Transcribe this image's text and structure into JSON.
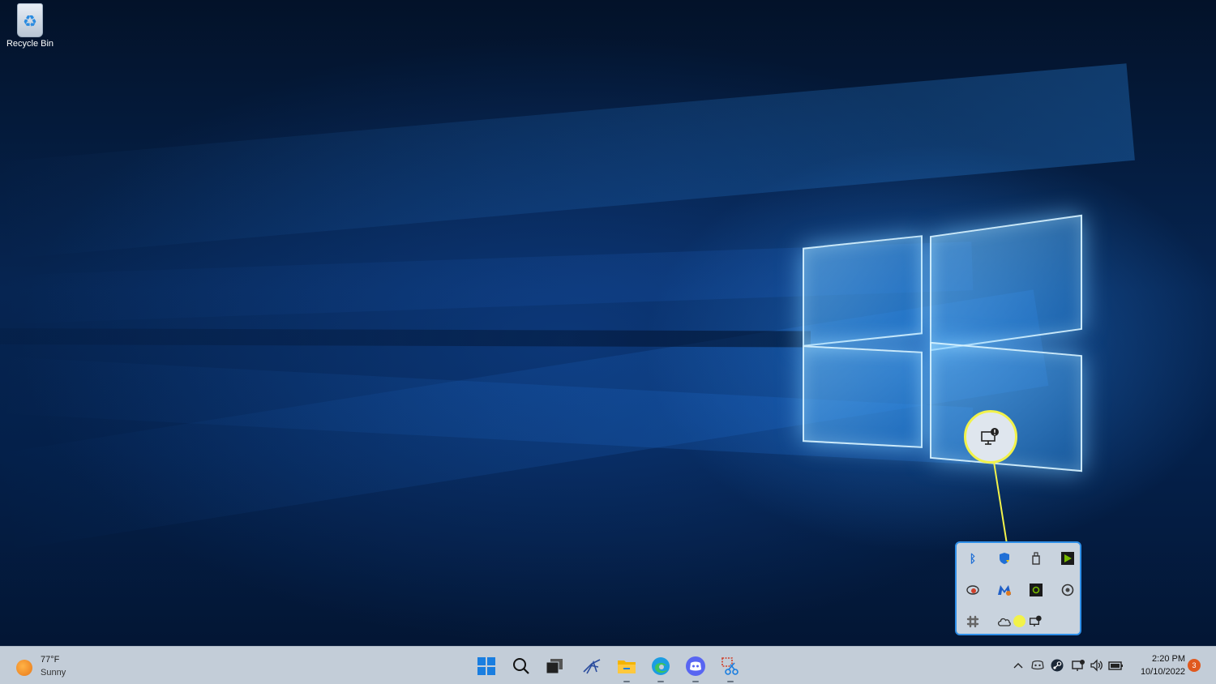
{
  "desktop": {
    "icons": [
      {
        "label": "Recycle Bin",
        "icon": "recycle-bin-icon"
      }
    ],
    "wallpaper": "windows-logo-light-beams"
  },
  "tray_overflow": {
    "icons": [
      "bluetooth-icon",
      "windows-security-icon",
      "usb-drive-icon",
      "nvidia-icon",
      "geforce-experience-icon",
      "malwarebytes-icon",
      "nvidia-broadcast-icon",
      "power-icon",
      "slack-icon",
      "onedrive-icon",
      "project-display-icon"
    ],
    "highlighted_icon": "project-display-icon",
    "highlight_color": "#f2f24a",
    "border_color": "#2f8fe8"
  },
  "taskbar": {
    "weather": {
      "temp": "77°F",
      "condition": "Sunny"
    },
    "pinned": [
      "start-icon",
      "search-icon",
      "task-view-icon",
      "app-icon",
      "file-explorer-icon",
      "edge-icon",
      "discord-icon",
      "snipping-tool-icon"
    ],
    "system_tray": [
      "show-hidden-icons-chevron",
      "discord-tray-icon",
      "steam-icon",
      "network-icon",
      "volume-icon",
      "battery-icon"
    ],
    "clock": {
      "time": "2:20 PM",
      "date": "10/10/2022"
    },
    "notification_count": "3"
  }
}
